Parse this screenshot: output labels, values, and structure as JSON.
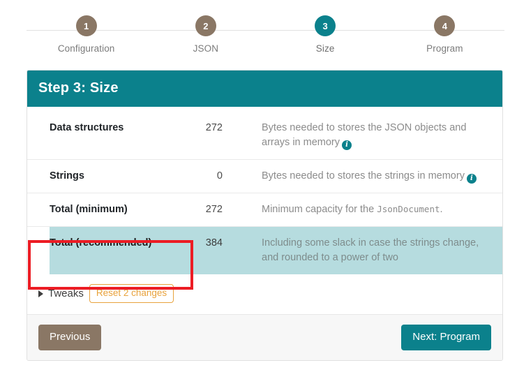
{
  "stepper": {
    "steps": [
      {
        "number": "1",
        "label": "Configuration",
        "active": false
      },
      {
        "number": "2",
        "label": "JSON",
        "active": false
      },
      {
        "number": "3",
        "label": "Size",
        "active": true
      },
      {
        "number": "4",
        "label": "Program",
        "active": false
      }
    ]
  },
  "card": {
    "title": "Step 3: Size",
    "rows": [
      {
        "label": "Data structures",
        "value": "272",
        "desc_before": "Bytes needed to stores the JSON objects and arrays in memory",
        "desc_code": "",
        "desc_after": "",
        "has_info": true,
        "highlighted": false
      },
      {
        "label": "Strings",
        "value": "0",
        "desc_before": "Bytes needed to stores the strings in memory",
        "desc_code": "",
        "desc_after": "",
        "has_info": true,
        "highlighted": false
      },
      {
        "label": "Total (minimum)",
        "value": "272",
        "desc_before": "Minimum capacity for the ",
        "desc_code": "JsonDocument",
        "desc_after": ".",
        "has_info": false,
        "highlighted": false
      },
      {
        "label": "Total (recommended)",
        "value": "384",
        "desc_before": "Including some slack in case the strings change, and rounded to a power of two",
        "desc_code": "",
        "desc_after": "",
        "has_info": false,
        "highlighted": true
      }
    ],
    "tweaks": {
      "toggle_label": "Tweaks",
      "reset_label": "Reset 2 changes"
    },
    "footer": {
      "previous_label": "Previous",
      "next_label": "Next: Program"
    }
  },
  "annotation": {
    "color": "#ec1c24"
  },
  "colors": {
    "accent_teal": "#0b818c",
    "step_inactive": "#8a7765",
    "highlight_row": "#b6dcdf",
    "reset_orange": "#e8a33d"
  },
  "icons": {
    "info": "i"
  }
}
